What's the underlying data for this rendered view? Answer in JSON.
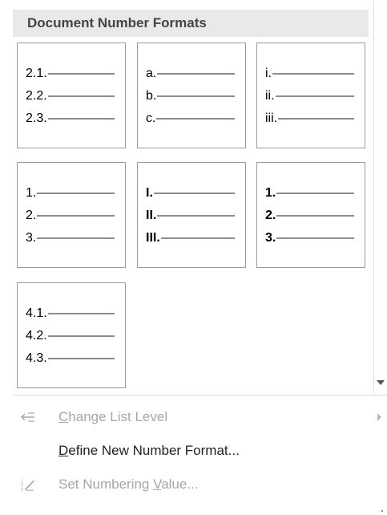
{
  "panel": {
    "title": "Document Number Formats"
  },
  "formats": [
    {
      "rows": [
        "2.1.",
        "2.2.",
        "2.3."
      ],
      "bold": false
    },
    {
      "rows": [
        "a.",
        "b.",
        "c."
      ],
      "bold": false
    },
    {
      "rows": [
        "i.",
        "ii.",
        "iii."
      ],
      "bold": false
    },
    {
      "rows": [
        "1.",
        "2.",
        "3."
      ],
      "bold": false
    },
    {
      "rows": [
        "I.",
        "II.",
        "III."
      ],
      "bold": true
    },
    {
      "rows": [
        "1.",
        "2.",
        "3."
      ],
      "bold": true
    },
    {
      "rows": [
        "4.1.",
        "4.2.",
        "4.3."
      ],
      "bold": false
    }
  ],
  "menu": {
    "change_list_level": {
      "pre": "",
      "key": "C",
      "post": "hange List Level",
      "enabled": false,
      "icon": "change-list-level-icon"
    },
    "define_new_number_format": {
      "pre": "",
      "key": "D",
      "post": "efine New Number Format...",
      "enabled": true
    },
    "set_numbering_value": {
      "pre": "Set Numbering ",
      "key": "V",
      "post": "alue...",
      "enabled": false,
      "icon": "set-numbering-value-icon"
    }
  },
  "colors": {
    "header_bg": "#e9e9e9",
    "tile_border": "#9a9a9a",
    "disabled_text": "#a6a6a6"
  }
}
